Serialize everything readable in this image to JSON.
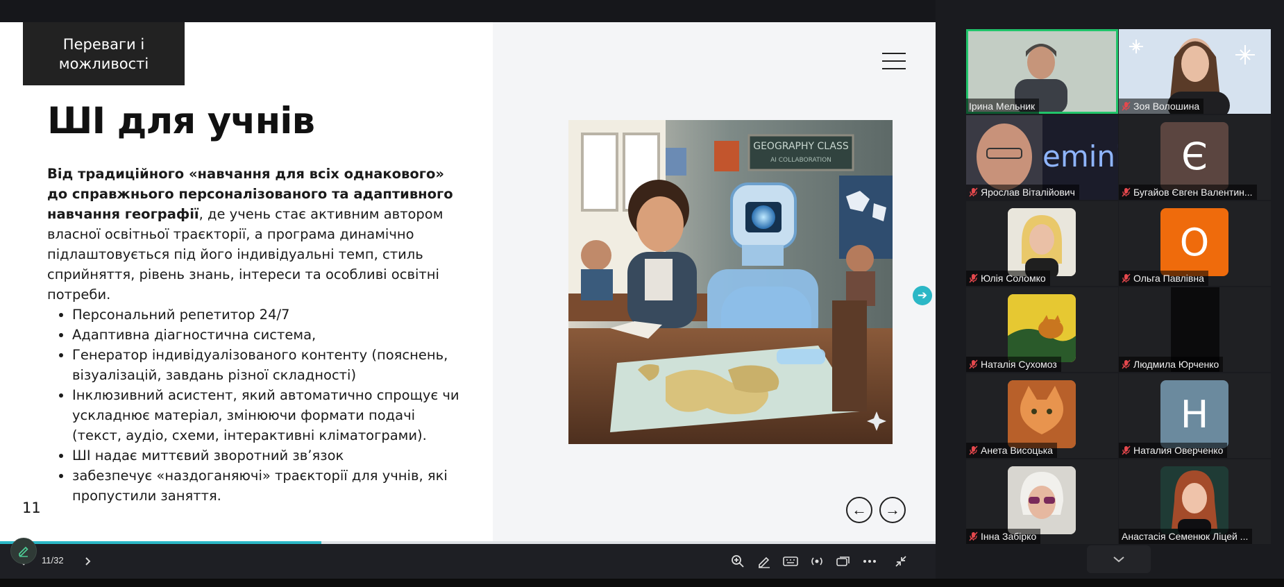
{
  "slide": {
    "tab_title": "Переваги і\nможливості",
    "title": "ШІ для учнів",
    "intro_bold": "Від традиційного «навчання для всіх однакового» до справжнього персоналізованого та адаптивного навчання географії",
    "intro_rest": ", де учень стає активним автором власної освітньої траєкторії, а програма динамічно підлаштовується під його індивідуальні темп, стиль сприйняття, рівень знань, інтереси та особливі освітні потреби.",
    "bullets": [
      "Персональний репетитор 24/7",
      "Адаптивна діагностична система,",
      "Генератор індивідуалізованого контенту (пояснень, візуалізацій, завдань різної складності)",
      "Інклюзивний асистент, який автоматично спрощує чи ускладнює матеріал, змінюючи формати подачі (текст, аудіо, схеми, інтерактивні кліматограми).",
      "ШІ надає миттєвий зворотний зв’язок",
      "забезпечує «наздоганяючі» траєкторії для учнів, які пропустили заняття."
    ],
    "page_number": "11",
    "image_text": {
      "board_line1": "GEOGRAPHY CLASS",
      "board_line2": "AI COLLABORATION"
    },
    "prev_arrow": "←",
    "next_arrow": "→"
  },
  "progress": {
    "current": 11,
    "total": 32
  },
  "toolbar": {
    "page_counter": "11/32",
    "buttons": [
      "zoom-in-icon",
      "annotate-icon",
      "keyboard-icon",
      "broadcast-icon",
      "screens-icon",
      "more-icon",
      "exit-fullscreen-icon"
    ]
  },
  "participants": [
    {
      "name": "Ірина Мельник",
      "type": "video",
      "active": true,
      "muted": false
    },
    {
      "name": "Зоя Волошина",
      "type": "video",
      "active": false,
      "muted": true
    },
    {
      "name": "Ярослав Віталійович",
      "type": "video",
      "active": false,
      "muted": true,
      "overlay": "emini"
    },
    {
      "name": "Бугайов Євген Валентин...",
      "type": "letter",
      "letter": "Є",
      "color": "#5b4540",
      "muted": true
    },
    {
      "name": "Юлія Соломко",
      "type": "photo",
      "color": "#e9e3cf",
      "muted": true
    },
    {
      "name": "Ольга Павлівна",
      "type": "letter",
      "letter": "О",
      "color": "#ef6b0c",
      "muted": true
    },
    {
      "name": "Наталія Сухомоз",
      "type": "photo",
      "color": "#cfb330",
      "muted": true
    },
    {
      "name": "Людмила Юрченко",
      "type": "video",
      "color": "#131313",
      "muted": true
    },
    {
      "name": "Анета Висоцька",
      "type": "photo",
      "color": "#d07a3a",
      "muted": true
    },
    {
      "name": "Наталия Оверченко",
      "type": "letter",
      "letter": "Н",
      "color": "#6b8a9e",
      "muted": true
    },
    {
      "name": "Інна Забірко",
      "type": "photo",
      "color": "#c9c7c2",
      "muted": true
    },
    {
      "name": "Анастасія Семенюк Ліцей ...",
      "type": "photo",
      "color": "#1d3a34",
      "muted": false
    }
  ],
  "colors": {
    "accent": "#2bb7c6",
    "active_speaker": "#21c46b",
    "muted_mic": "#e5484d"
  }
}
